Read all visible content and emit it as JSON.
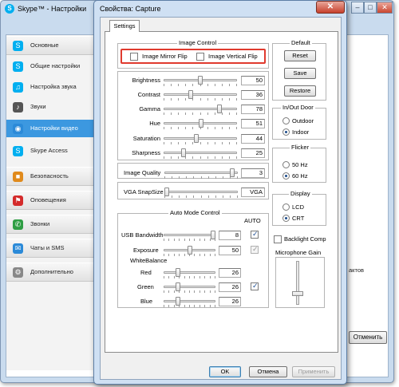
{
  "skype": {
    "title": "Skype™ - Настройки",
    "sidebar": [
      {
        "label": "Основные",
        "icon": "skype-logo-icon",
        "type": "header"
      },
      {
        "label": "Общие настройки",
        "icon": "skype-logo-icon",
        "type": "item"
      },
      {
        "label": "Настройка звука",
        "icon": "headset-icon",
        "type": "item"
      },
      {
        "label": "Звуки",
        "icon": "speaker-icon",
        "type": "item"
      },
      {
        "label": "Настройки видео",
        "icon": "webcam-icon",
        "type": "item",
        "selected": true
      },
      {
        "label": "Skype Access",
        "icon": "skype-logo-icon",
        "type": "item"
      },
      {
        "label": "Безопасность",
        "icon": "lock-icon",
        "type": "header"
      },
      {
        "label": "Оповещения",
        "icon": "flag-icon",
        "type": "header"
      },
      {
        "label": "Звонки",
        "icon": "phone-icon",
        "type": "header"
      },
      {
        "label": "Чаты и SMS",
        "icon": "chat-icon",
        "type": "header"
      },
      {
        "label": "Дополнительно",
        "icon": "gear-icon",
        "type": "header"
      }
    ],
    "partial_text": "актов",
    "cancel_button": "Отменить",
    "min_btn": "–",
    "max_btn": "□",
    "close_btn": "✕"
  },
  "dialog": {
    "title": "Свойства: Capture",
    "close_btn": "✕",
    "tab": "Settings",
    "image_control": {
      "title": "Image Control",
      "mirror_label": "Image Mirror Flip",
      "vertical_label": "Image Vertical Flip",
      "mirror_checked": false,
      "vertical_checked": false
    },
    "sliders": [
      {
        "label": "Brightness",
        "value": "50",
        "level": 0.5
      },
      {
        "label": "Contrast",
        "value": "36",
        "level": 0.36
      },
      {
        "label": "Gamma",
        "value": "78",
        "level": 0.78
      },
      {
        "label": "Hue",
        "value": "51",
        "level": 0.51
      },
      {
        "label": "Saturation",
        "value": "44",
        "level": 0.44
      },
      {
        "label": "Sharpness",
        "value": "25",
        "level": 0.25
      }
    ],
    "image_quality": {
      "label": "Image Quality",
      "value": "3",
      "level": 0.95
    },
    "vga_snapsize": {
      "label": "VGA SnapSize",
      "value": "VGA",
      "level": 0.0
    },
    "auto_mode": {
      "title": "Auto Mode Control",
      "auto_header": "AUTO",
      "usb_bandwidth": {
        "label": "USB Bandwidth",
        "value": "8",
        "level": 1.0,
        "auto": true
      },
      "exposure": {
        "label": "Exposure",
        "value": "50",
        "level": 0.5,
        "auto": true
      },
      "white_balance_label": "WhiteBalance",
      "red": {
        "label": "Red",
        "value": "26",
        "level": 0.25
      },
      "green": {
        "label": "Green",
        "value": "26",
        "level": 0.25,
        "auto": true
      },
      "blue": {
        "label": "Blue",
        "value": "26",
        "level": 0.25
      }
    },
    "default_group": {
      "title": "Default",
      "reset": "Reset",
      "save": "Save",
      "restore": "Restore"
    },
    "inout_door": {
      "title": "In/Out Door",
      "outdoor": "Outdoor",
      "indoor": "Indoor",
      "selected": "Indoor"
    },
    "flicker": {
      "title": "Flicker",
      "hz50": "50 Hz",
      "hz60": "60 Hz",
      "selected": "60 Hz"
    },
    "display": {
      "title": "Display",
      "lcd": "LCD",
      "crt": "CRT",
      "selected": "CRT"
    },
    "backlight_comp": {
      "label": "Backlight Comp",
      "checked": false
    },
    "mic_gain": {
      "label": "Microphone Gain",
      "level": 0.2
    },
    "buttons": {
      "ok": "OK",
      "cancel": "Отмена",
      "apply": "Применить"
    }
  },
  "colors": {
    "highlight_box": "#e03a2e",
    "selected_item": "#3c98e0",
    "dialog_frame": "#cfe0f3"
  }
}
